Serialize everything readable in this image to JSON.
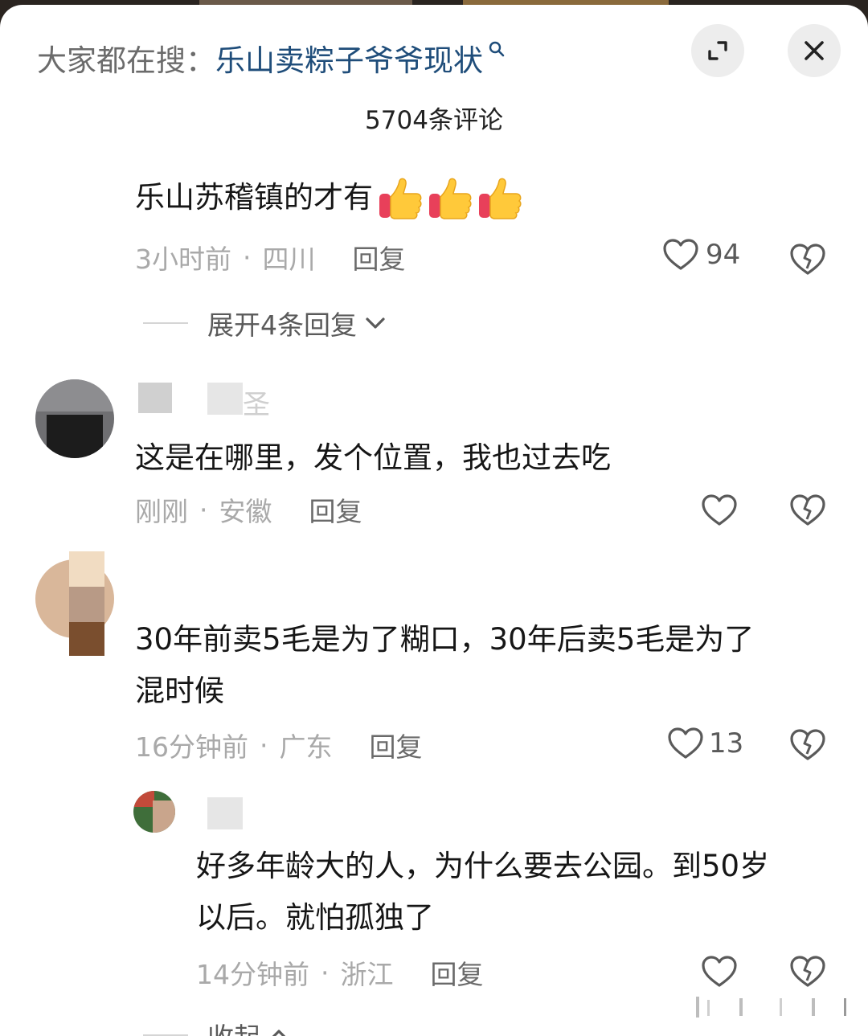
{
  "search": {
    "prefix": "大家都在搜：",
    "term": "乐山卖粽子爷爷现状"
  },
  "header": {
    "comment_count": "5704条评论"
  },
  "comments": [
    {
      "text": "乐山苏稽镇的才有",
      "emoji": "thumbs-up-icon",
      "time": "3小时前",
      "location": "四川",
      "reply_label": "回复",
      "likes": "94",
      "expand_label": "展开4条回复"
    },
    {
      "name_visible": "圣",
      "text": "这是在哪里，发个位置，我也过去吃",
      "time": "刚刚",
      "location": "安徽",
      "reply_label": "回复",
      "likes": ""
    },
    {
      "text_line1": "30年前卖5毛是为了糊口，30年后卖5毛是为了",
      "text_line2": "混时候",
      "time": "16分钟前",
      "location": "广东",
      "reply_label": "回复",
      "likes": "13"
    },
    {
      "text_line1": "好多年龄大的人，为什么要去公园。到50岁",
      "text_line2": "以后。就怕孤独了",
      "time": "14分钟前",
      "location": "浙江",
      "reply_label": "回复",
      "likes": "",
      "collapse_label": "收起"
    }
  ],
  "meta_separator": "·",
  "colors": {
    "search_term": "#1f4d7a",
    "meta_gray": "#a9a9a9",
    "text": "#161616"
  }
}
